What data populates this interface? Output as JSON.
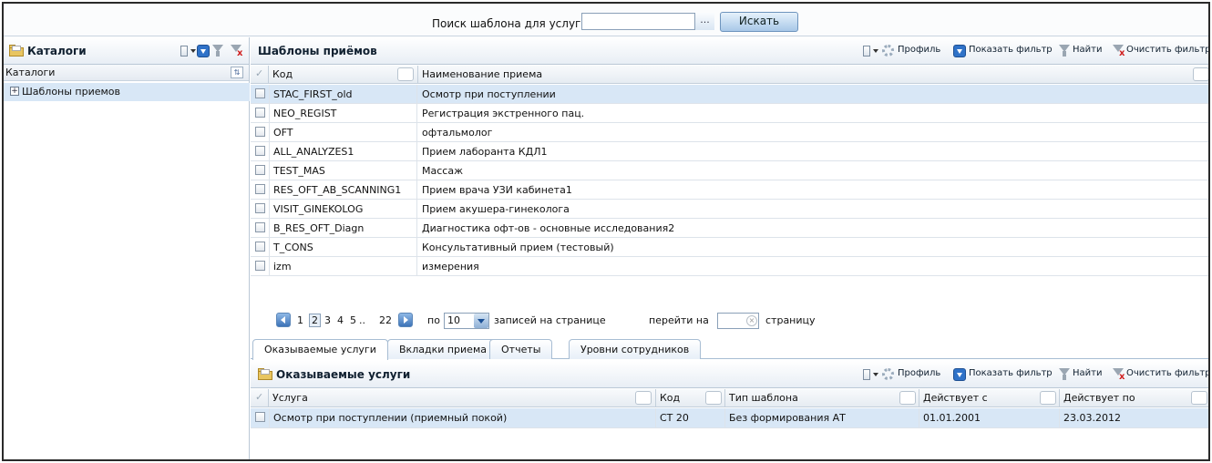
{
  "search": {
    "label": "Поиск шаблона для услуги:",
    "value": "",
    "lookup_label": "...",
    "button_label": "Искать"
  },
  "left_panel": {
    "title": "Каталоги",
    "column_label": "Каталоги",
    "tree": [
      {
        "label": "Шаблоны приемов",
        "expanded": false,
        "selected": true
      }
    ]
  },
  "templates": {
    "title": "Шаблоны приёмов",
    "toolbar": {
      "profile": "Профиль",
      "show_filter": "Показать фильтр",
      "find": "Найти",
      "clear_filter": "Очистить фильтр"
    },
    "columns": {
      "code": "Код",
      "name": "Наименование приема"
    },
    "rows": [
      {
        "code": "STAC_FIRST_old",
        "name": "Осмотр при поступлении",
        "selected": true
      },
      {
        "code": "NEO_REGIST",
        "name": "Регистрация экстренного пац."
      },
      {
        "code": "OFT",
        "name": "офтальмолог"
      },
      {
        "code": "ALL_ANALYZES1",
        "name": "Прием лаборанта КДЛ1"
      },
      {
        "code": "TEST_MAS",
        "name": "Массаж"
      },
      {
        "code": "RES_OFT_AB_SCANNING1",
        "name": "Прием врача УЗИ кабинета1"
      },
      {
        "code": "VISIT_GINEKOLOG",
        "name": "Прием акушера-гинеколога"
      },
      {
        "code": "B_RES_OFT_Diagn",
        "name": "Диагностика офт-ов - основные исследования2"
      },
      {
        "code": "T_CONS",
        "name": "Консультативный прием (тестовый)"
      },
      {
        "code": "izm",
        "name": "измерения"
      }
    ]
  },
  "pager": {
    "pages": [
      "1",
      "2",
      "3",
      "4",
      "5",
      "..",
      "22"
    ],
    "current_page": "2",
    "per_page_prefix": "по",
    "per_page": "10",
    "per_page_suffix": "записей на странице",
    "goto_prefix": "перейти на",
    "goto_value": "",
    "goto_suffix": "страницу"
  },
  "tabs": [
    {
      "label": "Оказываемые услуги",
      "active": true
    },
    {
      "label": "Вкладки приема",
      "active": false
    },
    {
      "label": "Отчеты",
      "active": false
    },
    {
      "label": "Уровни сотрудников",
      "active": false
    }
  ],
  "services": {
    "title": "Оказываемые услуги",
    "toolbar": {
      "profile": "Профиль",
      "show_filter": "Показать фильтр",
      "find": "Найти",
      "clear_filter": "Очистить фильтр"
    },
    "columns": {
      "service": "Услуга",
      "code": "Код",
      "template_type": "Тип шаблона",
      "valid_from": "Действует с",
      "valid_to": "Действует по"
    },
    "rows": [
      {
        "service": "Осмотр при поступлении (приемный покой)",
        "code": "СТ 20",
        "template_type": "Без формирования АТ",
        "valid_from": "01.01.2001",
        "valid_to": "23.03.2012",
        "selected": true
      }
    ]
  }
}
